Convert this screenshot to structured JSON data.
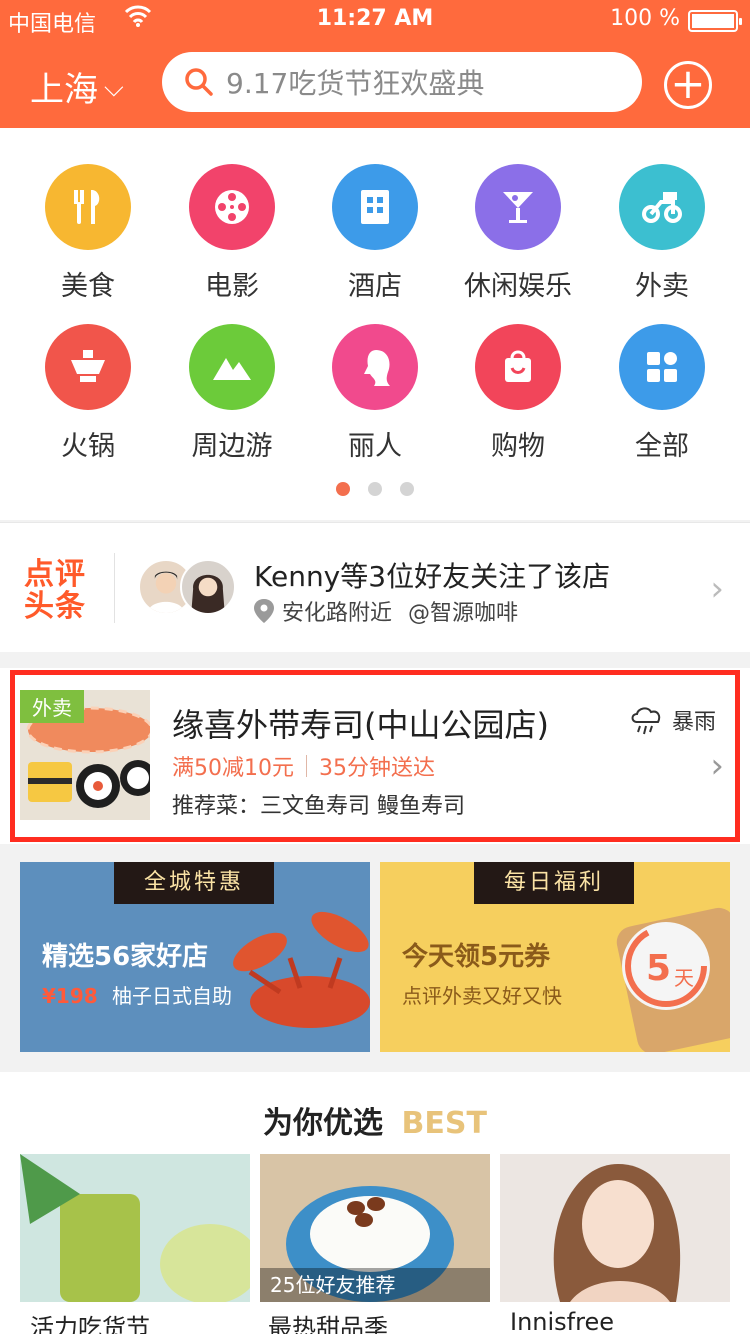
{
  "status": {
    "carrier": "中国电信",
    "time": "11:27 AM",
    "battery_text": "100 %"
  },
  "header": {
    "city": "上海",
    "search_placeholder": "9.17吃货节狂欢盛典"
  },
  "categories": [
    {
      "label": "美食",
      "icon": "cutlery-icon",
      "color": "#f7b731"
    },
    {
      "label": "电影",
      "icon": "film-reel-icon",
      "color": "#f2436b"
    },
    {
      "label": "酒店",
      "icon": "building-icon",
      "color": "#3d9be9"
    },
    {
      "label": "休闲娱乐",
      "icon": "cocktail-icon",
      "color": "#8b6fe8"
    },
    {
      "label": "外卖",
      "icon": "scooter-icon",
      "color": "#3cbfd0"
    },
    {
      "label": "火锅",
      "icon": "hotpot-icon",
      "color": "#f1554b"
    },
    {
      "label": "周边游",
      "icon": "mountain-icon",
      "color": "#6ccb3a"
    },
    {
      "label": "丽人",
      "icon": "woman-face-icon",
      "color": "#f14a8d"
    },
    {
      "label": "购物",
      "icon": "shopping-bag-icon",
      "color": "#f2455a"
    },
    {
      "label": "全部",
      "icon": "grid-icon",
      "color": "#3d9be9"
    }
  ],
  "headline": {
    "brand_line1": "点评",
    "brand_line2": "头条",
    "text": "Kenny等3位好友关注了该店",
    "location": "安化路附近",
    "shop": "@智源咖啡"
  },
  "takeaway": {
    "tag": "外卖",
    "title": "缘喜外带寿司(中山公园店)",
    "weather": "暴雨",
    "promo": "满50减10元",
    "delivery": "35分钟送达",
    "recommend": "推荐菜：三文鱼寿司 鳗鱼寿司"
  },
  "banners": [
    {
      "badge": "全城特惠",
      "headline": "精选56家好店",
      "price": "¥198",
      "sub": "柚子日式自助"
    },
    {
      "badge": "每日福利",
      "headline": "今天领5元券",
      "sub": "点评外卖又好又快",
      "stamp_num": "5",
      "stamp_unit": "天"
    }
  ],
  "best": {
    "title": "为你优选",
    "title_en": "BEST",
    "tiles": [
      {
        "title": "活力吃货节",
        "overlay": ""
      },
      {
        "title": "最热甜品季",
        "overlay": "25位好友推荐"
      },
      {
        "title": "Innisfree",
        "overlay": ""
      }
    ]
  }
}
